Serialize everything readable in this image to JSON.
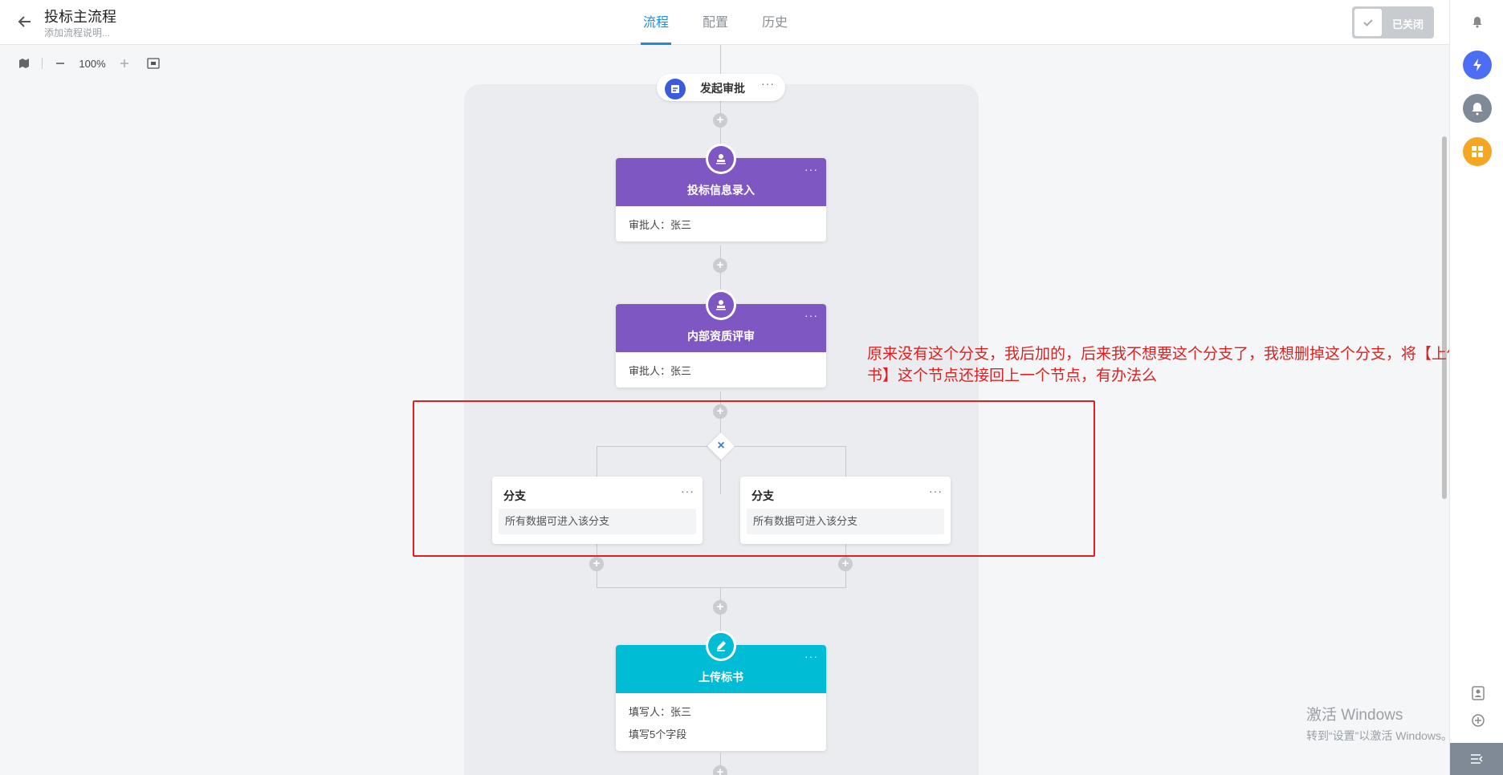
{
  "header": {
    "title": "投标主流程",
    "subtitle": "添加流程说明...",
    "tabs": [
      {
        "label": "流程",
        "active": true
      },
      {
        "label": "配置",
        "active": false
      },
      {
        "label": "历史",
        "active": false
      }
    ],
    "toggle_label": "已关闭"
  },
  "toolbar": {
    "zoom": "100%"
  },
  "flow": {
    "start_node": {
      "label": "发起审批"
    },
    "nodes": [
      {
        "title": "投标信息录入",
        "rows": [
          "审批人：张三"
        ]
      },
      {
        "title": "内部资质评审",
        "rows": [
          "审批人：张三"
        ]
      },
      {
        "title": "上传标书",
        "rows": [
          "填写人：张三",
          "填写5个字段"
        ]
      }
    ],
    "branches": [
      {
        "title": "分支",
        "desc": "所有数据可进入该分支"
      },
      {
        "title": "分支",
        "desc": "所有数据可进入该分支"
      }
    ],
    "more": "···",
    "plus": "+"
  },
  "annotation": "原来没有这个分支，我后加的，后来我不想要这个分支了，我想删掉这个分支，将【上传标书】这个节点还接回上一个节点，有办法么",
  "watermark": {
    "line1": "激活 Windows",
    "line2": "转到“设置”以激活 Windows。"
  },
  "colors": {
    "accent": "#1f8be0",
    "approve_header": "#7e57c2",
    "fill_header": "#00bcd4",
    "annotation_red": "#e02020"
  }
}
